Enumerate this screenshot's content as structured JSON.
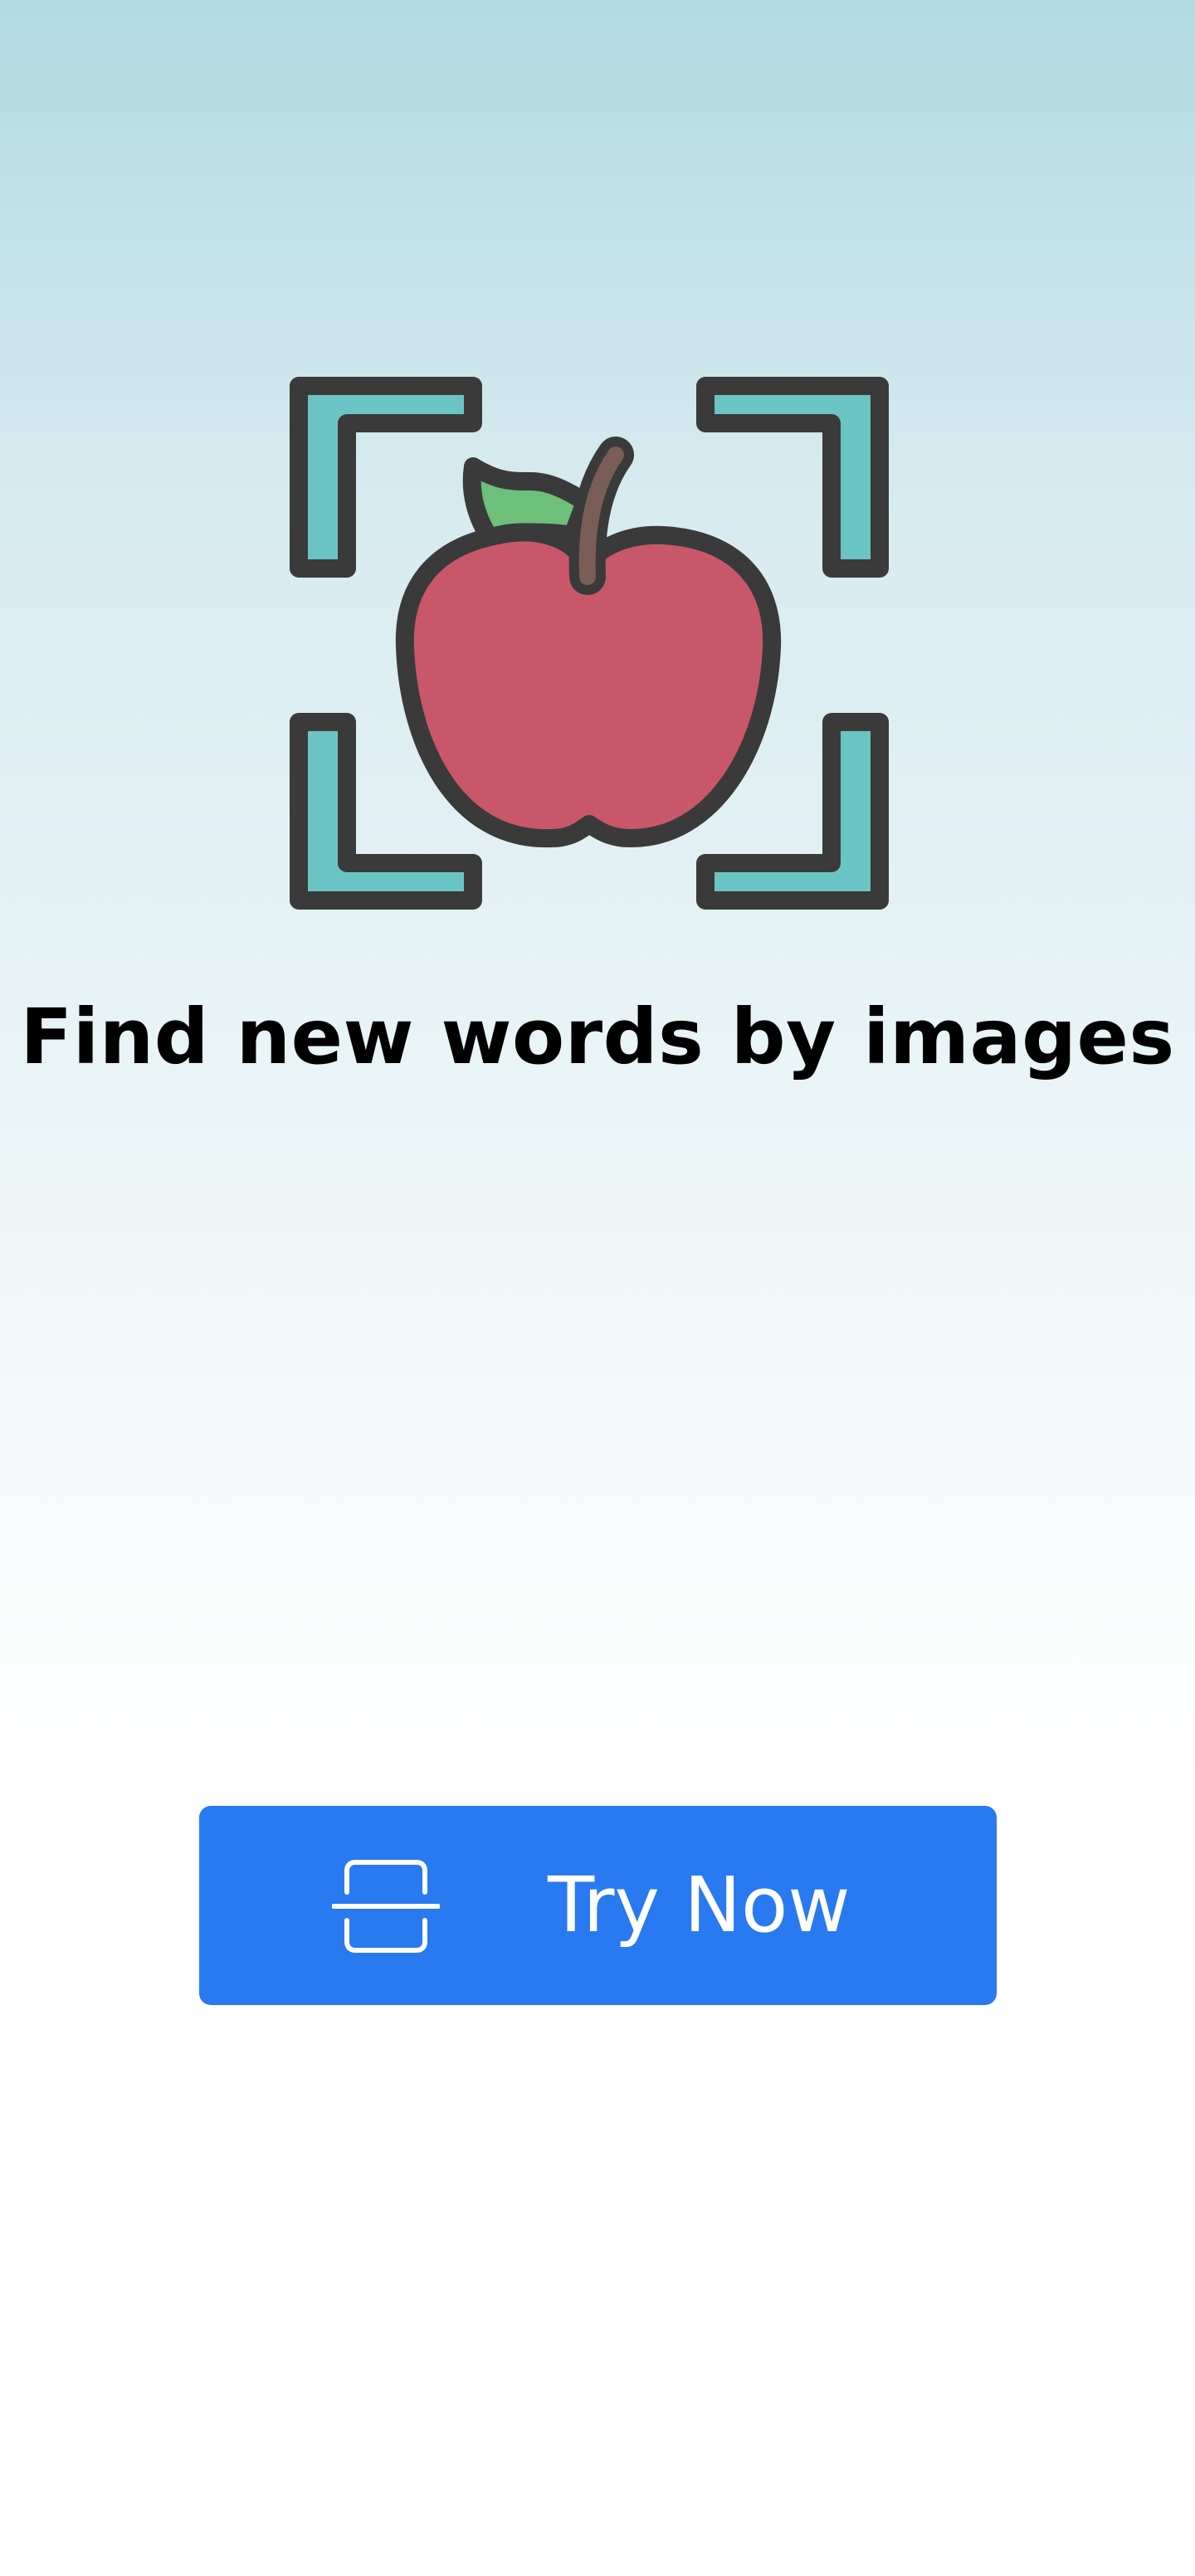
{
  "hero": {
    "icon": "apple-scan-icon",
    "headline": "Find new words by images"
  },
  "cta": {
    "label": "Try Now",
    "icon": "scan-icon",
    "color": "#2979f0"
  },
  "colors": {
    "background_top": "#b2d9e2",
    "background_bottom": "#ffffff",
    "frame_fill": "#6bc4c4",
    "outline": "#3a3a3a",
    "apple": "#c85869",
    "leaf": "#6dbf79",
    "stem": "#7a5d57"
  }
}
